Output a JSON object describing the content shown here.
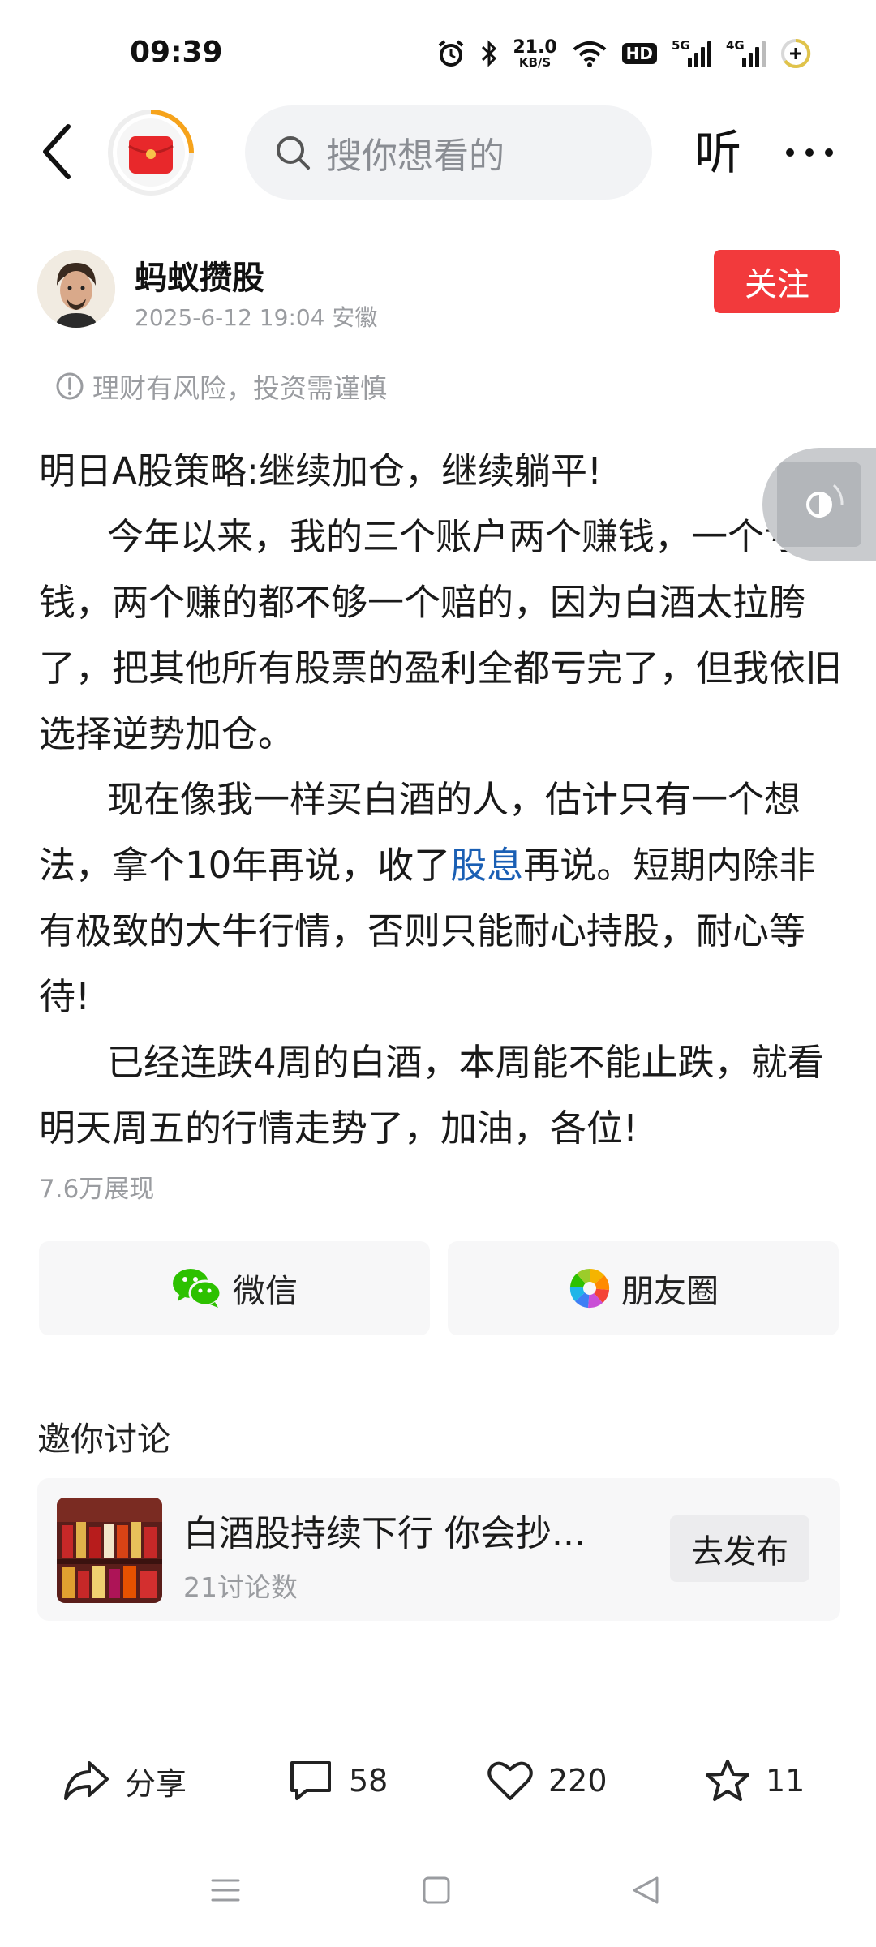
{
  "status_bar": {
    "time": "09:39",
    "net_speed_value": "21.0",
    "net_speed_unit": "KB/S",
    "hd_label": "HD",
    "signal1_label": "5G",
    "signal2_label": "4G"
  },
  "nav": {
    "search_placeholder": "搜你想看的",
    "listen_label": "听"
  },
  "author": {
    "name": "蚂蚁攒股",
    "meta": "2025-6-12 19:04 安徽",
    "follow_label": "关注"
  },
  "risk_note": "理财有风险，投资需谨慎",
  "article": {
    "title_line": "明日A股策略:继续加仓，继续躺平!",
    "para1": "今年以来，我的三个账户两个赚钱，一个亏钱，两个赚的都不够一个赔的，因为白酒太拉胯了，把其他所有股票的盈利全都亏完了，但我依旧选择逆势加仓。",
    "para2_before": "现在像我一样买白酒的人，估计只有一个想法，拿个10年再说，收了",
    "para2_link": "股息",
    "para2_after": "再说。短期内除非有极致的大牛行情，否则只能耐心持股，耐心等待!",
    "para3": "已经连跌4周的白酒，本周能不能止跌，就看明天周五的行情走势了，加油，各位!",
    "views": "7.6万展现"
  },
  "share": {
    "wechat_label": "微信",
    "moments_label": "朋友圈"
  },
  "discussion": {
    "section_title": "邀你讨论",
    "topic": "白酒股持续下行 你会抄...",
    "count": "21讨论数",
    "publish_label": "去发布"
  },
  "actions": {
    "share_label": "分享",
    "comments": "58",
    "likes": "220",
    "favorites": "11"
  },
  "colors": {
    "accent_red": "#f23a3c",
    "link_blue": "#1a5fb4",
    "muted_gray": "#9a9ca0"
  }
}
